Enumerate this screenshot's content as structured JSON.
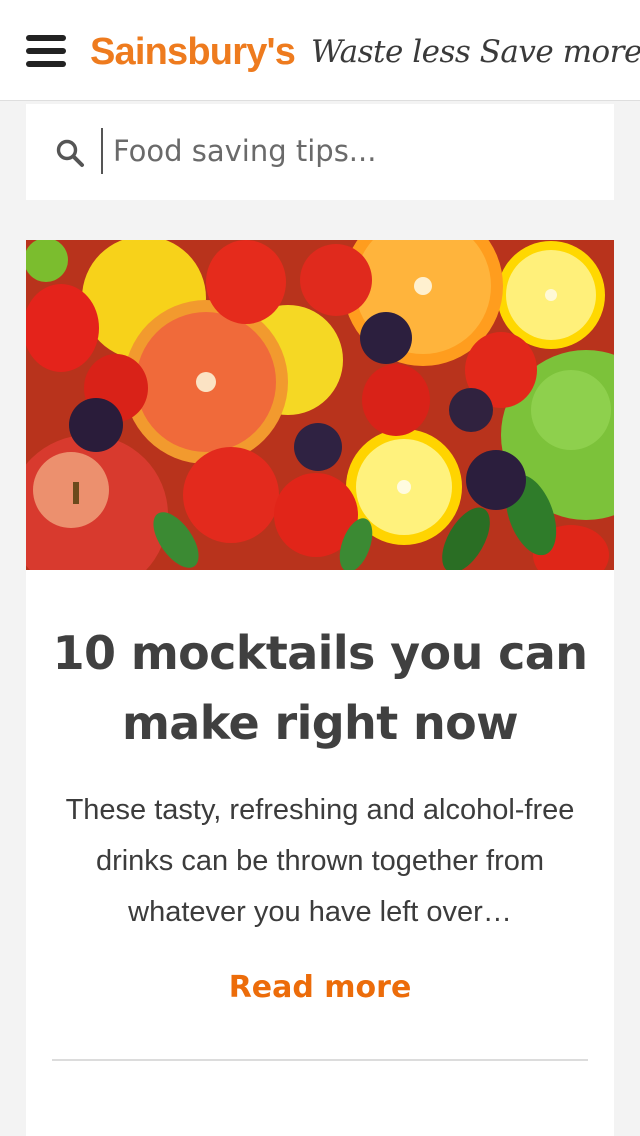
{
  "header": {
    "menu_label": "Menu",
    "logo": "Sainsbury's",
    "tagline": "Waste less Save more"
  },
  "search": {
    "placeholder": "Food saving tips...",
    "value": ""
  },
  "article": {
    "image_alt": "Colourful mix of fresh fruit",
    "title": "10 mocktails you can make right now",
    "description": "These tasty, refreshing and alcohol-free drinks can be thrown together from whatever you have left over…",
    "read_more": "Read more"
  },
  "colors": {
    "brand_orange": "#ee7b1e",
    "link_orange": "#ec6c0a",
    "text_dark": "#404040",
    "page_background": "#f3f3f3"
  },
  "icons": {
    "menu": "hamburger-icon",
    "search": "search-icon"
  }
}
